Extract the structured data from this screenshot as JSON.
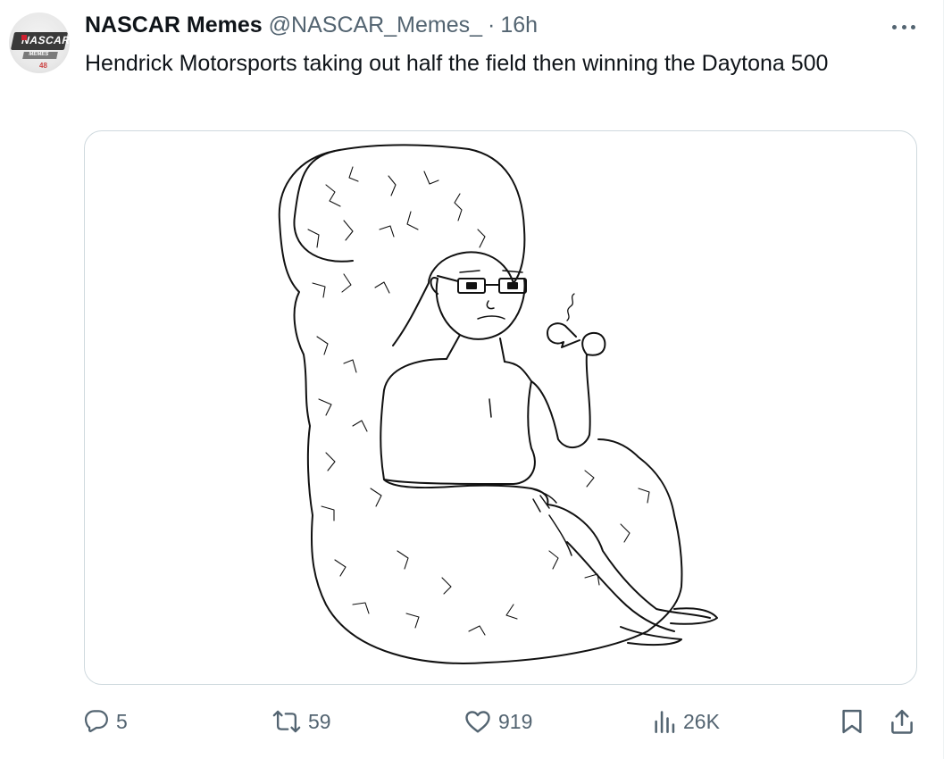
{
  "author": {
    "display_name": "NASCAR Memes",
    "handle": "@NASCAR_Memes_",
    "separator": "·",
    "time_ago": "16h",
    "avatar_logo_text": "NASCAR",
    "avatar_sub_text": "MEMES",
    "avatar_number": "48"
  },
  "tweet": {
    "text": "Hendrick Motorsports taking out half the field then winning the Daytona 500"
  },
  "media": {
    "icon": "meme-image"
  },
  "actions": {
    "reply_count": "5",
    "retweet_count": "59",
    "like_count": "919",
    "views_count": "26K"
  },
  "colors": {
    "text_primary": "#0f1419",
    "text_secondary": "#536471",
    "border": "#cfd9de"
  }
}
